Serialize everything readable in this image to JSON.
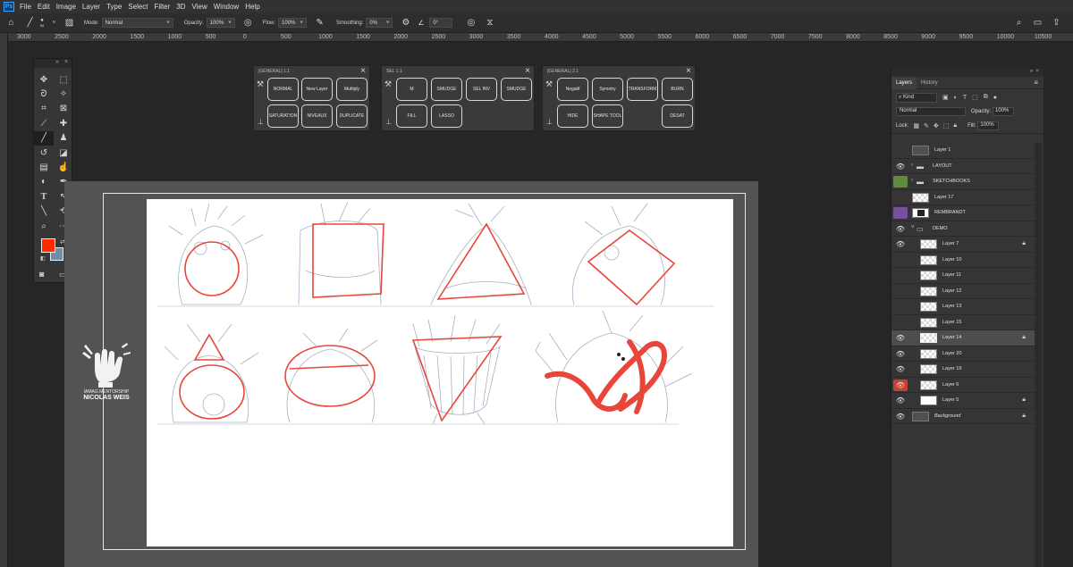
{
  "menubar": {
    "logo": "Ps",
    "items": [
      "File",
      "Edit",
      "Image",
      "Layer",
      "Type",
      "Select",
      "Filter",
      "3D",
      "View",
      "Window",
      "Help"
    ]
  },
  "options": {
    "brush_size": "55",
    "mode_label": "Mode:",
    "mode_value": "Normal",
    "opacity_label": "Opacity:",
    "opacity_value": "100%",
    "flow_label": "Flow:",
    "flow_value": "100%",
    "smoothing_label": "Smoothing:",
    "smoothing_value": "0%",
    "angle_value": "0°"
  },
  "ruler": {
    "ticks": [
      "3000",
      "2500",
      "2000",
      "1500",
      "1000",
      "500",
      "0",
      "500",
      "1000",
      "1500",
      "2000",
      "2500",
      "3000",
      "3500",
      "4000",
      "4500",
      "5000",
      "5500",
      "6000",
      "6500",
      "7000",
      "7500",
      "8000",
      "8500",
      "9000",
      "9500",
      "10000",
      "10500"
    ]
  },
  "panels": [
    {
      "title": "[GENERAL] 1.1",
      "buttons": [
        "NORMAL",
        "New Layer",
        "Multiply",
        "SATURATION",
        "NIVEAUX",
        "DUPLICATE"
      ]
    },
    {
      "title": "SEL 1.1",
      "buttons": [
        "M",
        "SMUDGE",
        "SEL INV",
        "SMUDGE",
        "FILL",
        "LASSO"
      ]
    },
    {
      "title": "[GENERAL] 2.1",
      "buttons": [
        "Negatif",
        "Symetry",
        "TRANSFORM",
        "BURN",
        "HIDE",
        "SHAPE TOOL",
        "DESAT"
      ]
    }
  ],
  "logo": {
    "line1": "IAMAG MENTORSHIP",
    "line2": "NICOLAS WEIS"
  },
  "colors": {
    "foreground": "#ff2a00",
    "background": "#6f8fa8",
    "sketch_red": "#e8463a"
  },
  "layers_panel": {
    "tabs": [
      "Layers",
      "History"
    ],
    "filter_kind": "Kind",
    "blend_mode": "Normal",
    "opacity_label": "Opacity:",
    "opacity_value": "100%",
    "lock_label": "Lock:",
    "fill_label": "Fill:",
    "fill_value": "100%",
    "layers": [
      {
        "name": "Layer 1",
        "visible": false
      },
      {
        "name": "LAYOUT",
        "visible": true,
        "folder": true
      },
      {
        "name": "SKETCHBOOKS",
        "visible": false,
        "folder": true
      },
      {
        "name": "Layer 17",
        "visible": false
      },
      {
        "name": "REMBRANDT",
        "visible": false
      },
      {
        "name": "DEMO",
        "visible": true,
        "folder": true
      },
      {
        "name": "Layer 7",
        "visible": true,
        "locked": true
      },
      {
        "name": "Layer 10",
        "visible": false
      },
      {
        "name": "Layer 11",
        "visible": false
      },
      {
        "name": "Layer 12",
        "visible": false
      },
      {
        "name": "Layer 13",
        "visible": false
      },
      {
        "name": "Layer 15",
        "visible": false
      },
      {
        "name": "Layer 14",
        "visible": true,
        "locked": true,
        "selected": true
      },
      {
        "name": "Layer 20",
        "visible": true
      },
      {
        "name": "Layer 19",
        "visible": true
      },
      {
        "name": "Layer 6",
        "visible": true
      },
      {
        "name": "Layer 5",
        "visible": true,
        "locked": true
      },
      {
        "name": "Background",
        "visible": true,
        "locked": true
      }
    ]
  }
}
